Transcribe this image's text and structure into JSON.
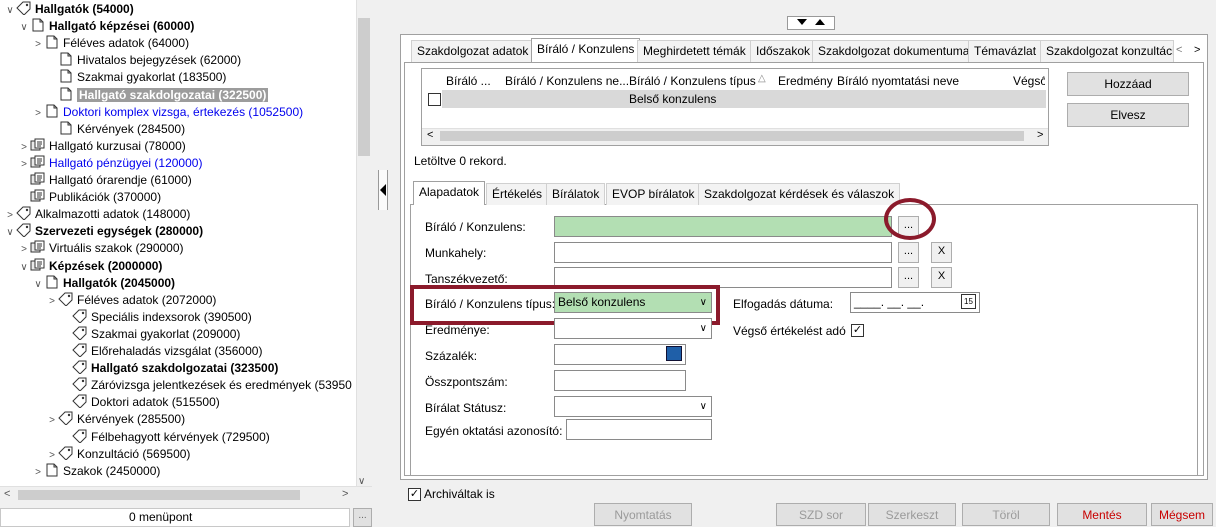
{
  "tree": {
    "rows": [
      {
        "label": "Hallgatók (54000)",
        "bold": true,
        "chev": "∨"
      },
      {
        "label": "Hallgató képzései (60000)",
        "bold": true,
        "chev": "∨"
      },
      {
        "label": "Féléves adatok (64000)",
        "chev": ">"
      },
      {
        "label": "Hivatalos bejegyzések (62000)"
      },
      {
        "label": "Szakmai gyakorlat (183500)"
      },
      {
        "label": "Hallgató szakdolgozatai (322500)",
        "selected": true
      },
      {
        "label": "Doktori komplex vizsga, értekezés (1052500)",
        "blue": true,
        "chev": ">"
      },
      {
        "label": "Kérvények (284500)"
      },
      {
        "label": "Hallgató kurzusai (78000)",
        "chev": ">"
      },
      {
        "label": "Hallgató pénzügyei (120000)",
        "blue": true,
        "chev": ">"
      },
      {
        "label": "Hallgató órarendje (61000)"
      },
      {
        "label": "Publikációk (370000)"
      },
      {
        "label": "Alkalmazotti adatok (148000)",
        "chev": ">"
      },
      {
        "label": "Szervezeti egységek (280000)",
        "bold": true,
        "chev": "∨"
      },
      {
        "label": "Virtuális szakok (290000)",
        "chev": ">"
      },
      {
        "label": "Képzések (2000000)",
        "bold": true,
        "chev": "∨"
      },
      {
        "label": "Hallgatók (2045000)",
        "bold": true,
        "chev": "∨"
      },
      {
        "label": "Féléves adatok (2072000)",
        "chev": ">"
      },
      {
        "label": "Speciális indexsorok (390500)"
      },
      {
        "label": "Szakmai gyakorlat (209000)"
      },
      {
        "label": "Előrehaladás vizsgálat (356000)"
      },
      {
        "label": "Hallgató szakdolgozatai (323500)",
        "bold": true
      },
      {
        "label": "Záróvizsga jelentkezések és eredmények (53950"
      },
      {
        "label": "Doktori adatok (515500)"
      },
      {
        "label": "Kérvények (285500)",
        "chev": ">"
      },
      {
        "label": "Félbehagyott kérvények (729500)"
      },
      {
        "label": "Konzultáció (569500)",
        "chev": ">"
      },
      {
        "label": "Szakok (2450000)",
        "chev": ">"
      }
    ],
    "menu_count": "0 menüpont"
  },
  "top_tabs": [
    "Szakdolgozat adatok",
    "Bíráló / Konzulens",
    "Meghirdetett témák",
    "Időszakok",
    "Szakdolgozat dokumentumai",
    "Témavázlat",
    "Szakdolgozat konzultáci"
  ],
  "grid": {
    "headers": [
      "Bíráló ...",
      "Bíráló / Konzulens ne...",
      "Bíráló / Konzulens típus",
      "Eredmény",
      "Bíráló nyomtatási neve",
      "Végső é"
    ],
    "row_type": "Belső konzulens",
    "status": "Letöltve 0 rekord."
  },
  "side_buttons": {
    "add": "Hozzáad",
    "remove": "Elvesz"
  },
  "sub_tabs": [
    "Alapadatok",
    "Értékelés",
    "Bírálatok",
    "EVOP bírálatok",
    "Szakdolgozat kérdések és válaszok"
  ],
  "form": {
    "reviewer_label": "Bíráló / Konzulens:",
    "workplace_label": "Munkahely:",
    "dept_head_label": "Tanszékvezető:",
    "type_label": "Bíráló / Konzulens típus:",
    "type_value": "Belső konzulens",
    "result_label": "Eredménye:",
    "percent_label": "Százalék:",
    "total_label": "Összpontszám:",
    "status_label": "Bírálat Státusz:",
    "edu_id_label": "Egyén oktatási azonosító:",
    "accept_date_label": "Elfogadás dátuma:",
    "accept_date_value": "____. __. __.",
    "final_eval_label": "Végső értékelést adó",
    "ellipsis": "...",
    "x": "X"
  },
  "archived_label": "Archiváltak is",
  "bottom_buttons": {
    "print": "Nyomtatás",
    "szd": "SZD sor",
    "edit": "Szerkeszt",
    "delete": "Töröl",
    "save": "Mentés",
    "cancel": "Mégsem"
  }
}
